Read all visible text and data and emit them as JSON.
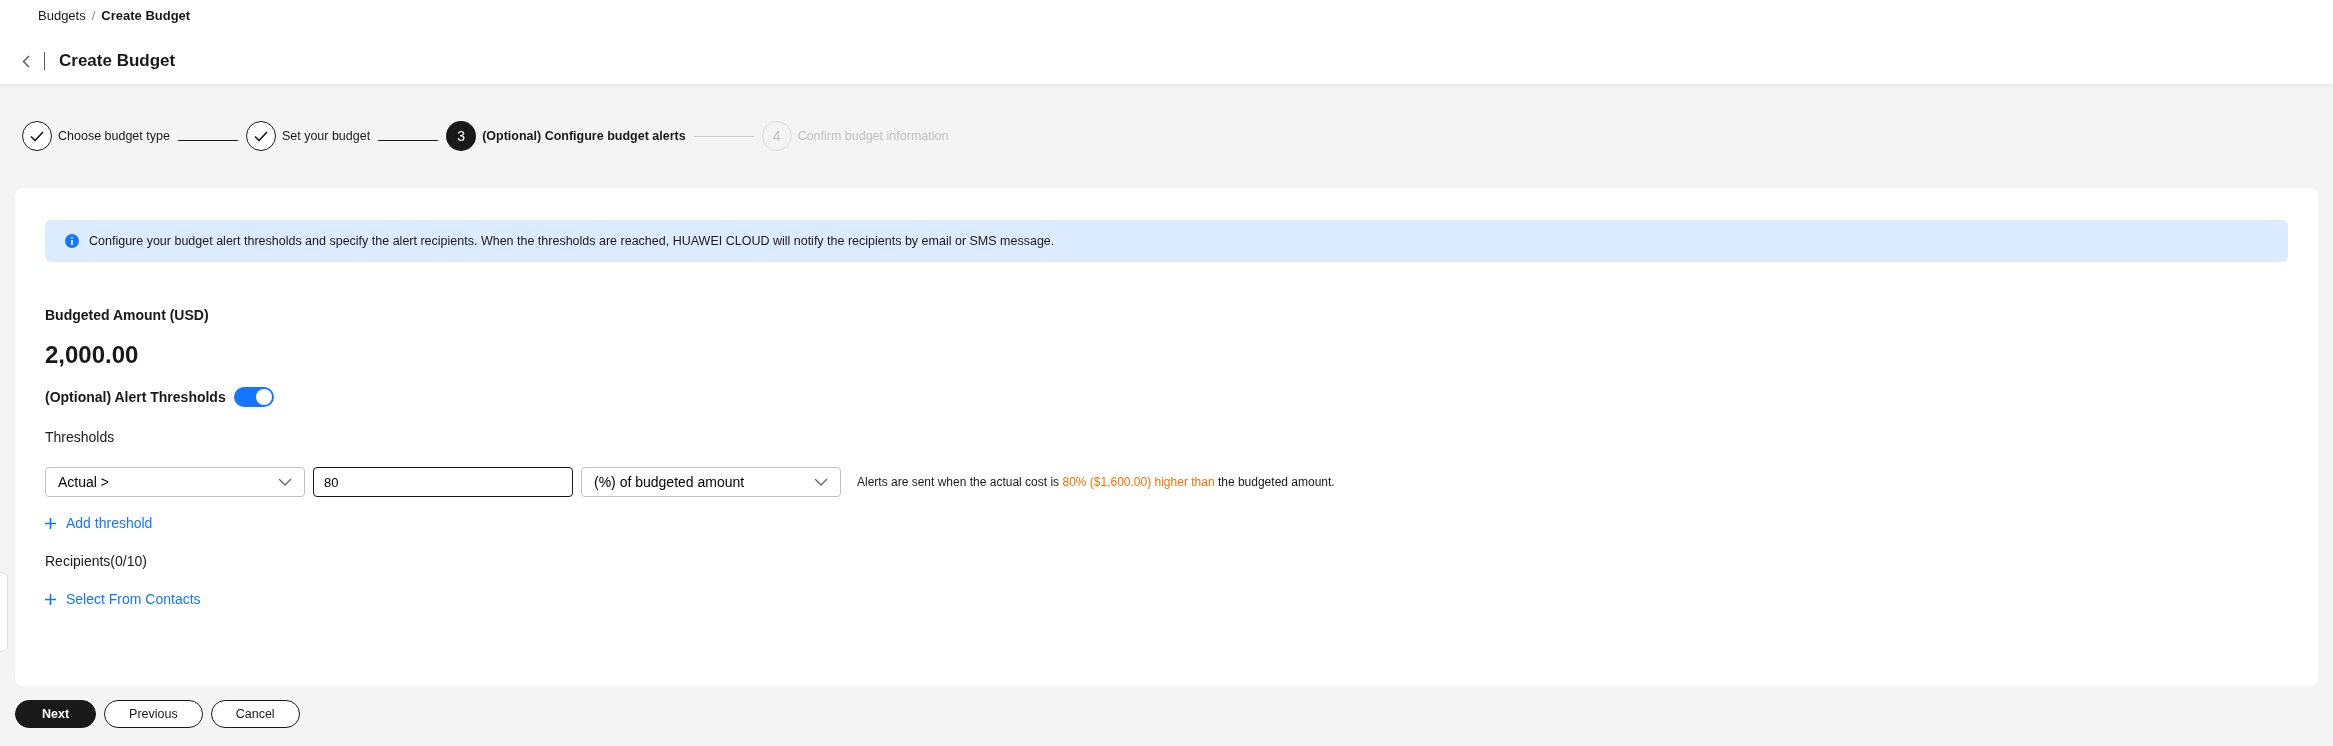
{
  "breadcrumb": {
    "items": [
      "Budgets",
      "Create Budget"
    ],
    "separator": "/"
  },
  "page_title": "Create Budget",
  "steps": [
    {
      "label": "Choose budget type",
      "kind": "done"
    },
    {
      "label": "Set your budget",
      "kind": "done"
    },
    {
      "number": "3",
      "label": "(Optional) Configure budget alerts",
      "kind": "current"
    },
    {
      "number": "4",
      "label": "Confirm budget information",
      "kind": "pending"
    }
  ],
  "info_message": "Configure your budget alert thresholds and specify the alert recipients. When the thresholds are reached, HUAWEI CLOUD will notify the recipients by email or SMS message.",
  "budgeted_amount": {
    "label": "Budgeted Amount (USD)",
    "value": "2,000.00"
  },
  "alert_thresholds": {
    "label": "(Optional) Alert Thresholds",
    "on": true
  },
  "thresholds": {
    "label": "Thresholds",
    "rows": [
      {
        "condition": "Actual >",
        "value": "80",
        "unit": "(%) of budgeted amount",
        "note_prefix": "Alerts are sent when the actual cost is",
        "note_highlight": "80% ($1,600.00) higher than",
        "note_suffix": "the budgeted amount."
      }
    ],
    "add_link": "Add threshold"
  },
  "recipients": {
    "label": "Recipients(0/10)",
    "add_link": "Select From Contacts"
  },
  "buttons": [
    {
      "label": "Next",
      "kind": "primary"
    },
    {
      "label": "Previous",
      "kind": "secondary"
    },
    {
      "label": "Cancel",
      "kind": "secondary"
    }
  ]
}
